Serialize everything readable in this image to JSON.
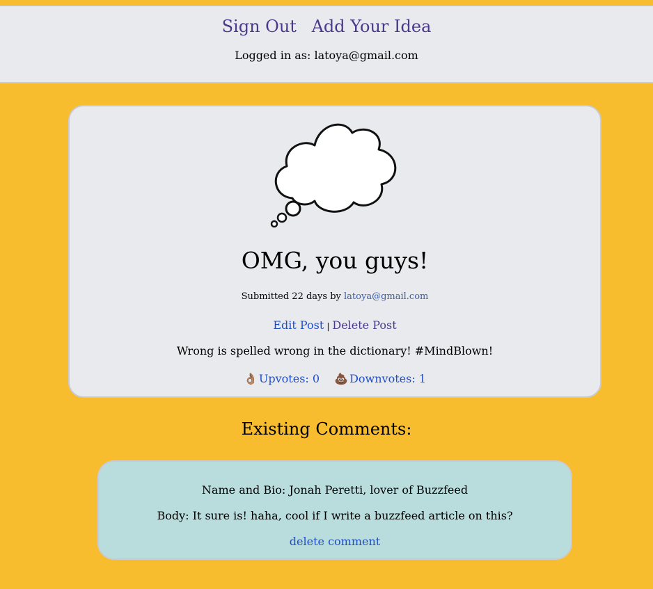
{
  "header": {
    "nav": {
      "sign_out": "Sign Out",
      "add_idea": "Add Your Idea"
    },
    "logged_in": "Logged in as: latoya@gmail.com"
  },
  "post": {
    "icon": "thought-cloud-icon",
    "title": "OMG, you guys!",
    "submitted_prefix": "Submitted 22 days by",
    "author": "latoya@gmail.com",
    "edit_label": "Edit Post",
    "separator": "|",
    "delete_label": "Delete Post",
    "body": "Wrong is spelled wrong in the dictionary! #MindBlown!",
    "upvotes": {
      "icon": "ok-hand-icon",
      "emoji": "👌🏽",
      "label": "Upvotes: 0"
    },
    "downvotes": {
      "icon": "poop-icon",
      "emoji": "💩",
      "label": "Downvotes: 1"
    }
  },
  "comments": {
    "heading": "Existing Comments:",
    "items": [
      {
        "name_bio": "Name and Bio: Jonah Peretti, lover of Buzzfeed",
        "body": "Body: It sure is! haha, cool if I write a buzzfeed article on this?",
        "delete_label": "delete comment"
      }
    ]
  },
  "colors": {
    "background": "#f7bd2f",
    "panel": "#e9eaee",
    "comment_panel": "#b9dcdd",
    "nav_link": "#4b3a8c",
    "link": "#1f4fc8"
  }
}
